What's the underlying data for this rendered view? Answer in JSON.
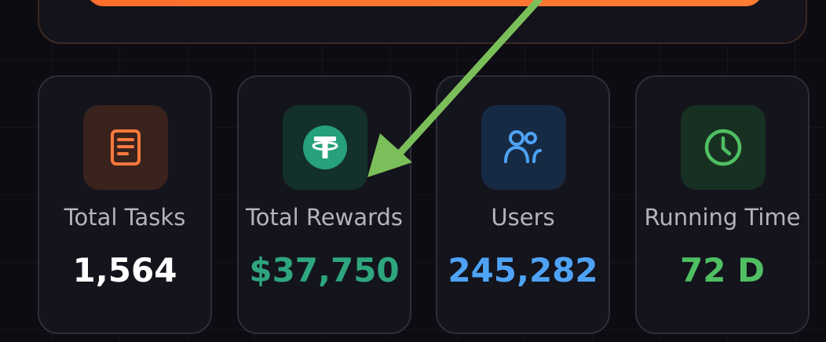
{
  "stats": [
    {
      "label": "Total Tasks",
      "value": "1,564",
      "icon": "document-icon",
      "accent": "#ff7a3d",
      "tile_bg": "#3a221d",
      "value_color": "#ffffff"
    },
    {
      "label": "Total Rewards",
      "value": "$37,750",
      "icon": "tether-icon",
      "accent": "#26a17b",
      "tile_bg": "#13302a",
      "value_color": "#2ea67e"
    },
    {
      "label": "Users",
      "value": "245,282",
      "icon": "users-icon",
      "accent": "#4ea3f5",
      "tile_bg": "#172a44",
      "value_color": "#4ea3f5"
    },
    {
      "label": "Running Time",
      "value": "72 D",
      "icon": "clock-icon",
      "accent": "#4fbf62",
      "tile_bg": "#183022",
      "value_color": "#4fbf62"
    }
  ],
  "annotation": {
    "arrow_color": "#7bbf5a"
  },
  "colors": {
    "background": "#0d0c13",
    "top_button": "#ff7330",
    "card_border": "#2e2e3a"
  }
}
